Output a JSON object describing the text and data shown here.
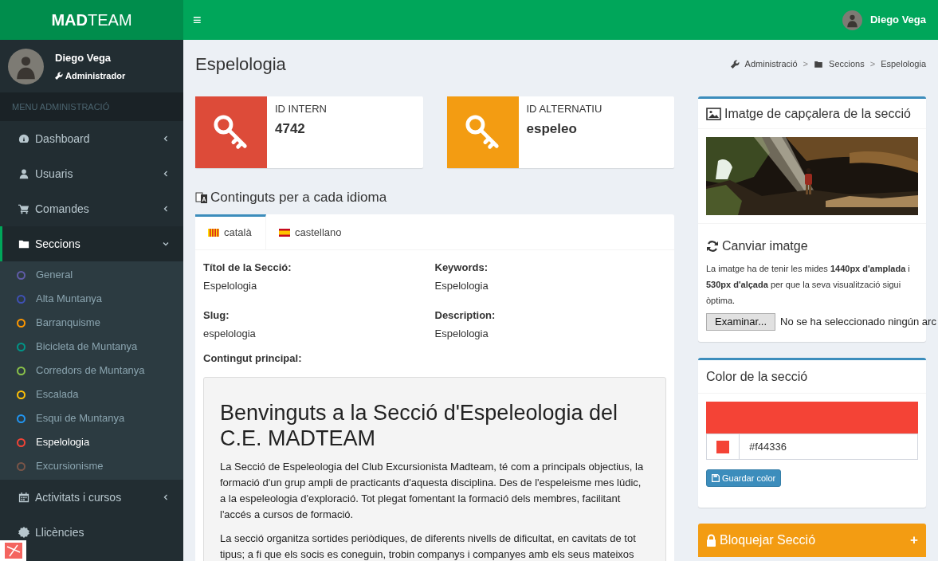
{
  "header": {
    "logo_bold": "MAD",
    "logo_rest": "TEAM",
    "menu_toggle": "≡",
    "user_name": "Diego Vega"
  },
  "sidebar": {
    "user": {
      "name": "Diego Vega",
      "role": "Administrador"
    },
    "menu_title": "MENU ADMINISTRACIÓ",
    "items": [
      {
        "label": "Dashboard",
        "expanded": false,
        "selected": false
      },
      {
        "label": "Usuaris",
        "expanded": false,
        "selected": false
      },
      {
        "label": "Comandes",
        "expanded": false,
        "selected": false
      },
      {
        "label": "Seccions",
        "expanded": true,
        "selected": true,
        "children": [
          {
            "label": "General",
            "color": "#605ca8",
            "selected": false
          },
          {
            "label": "Alta Muntanya",
            "color": "#3f51b5",
            "selected": false
          },
          {
            "label": "Barranquisme",
            "color": "#ff9800",
            "selected": false
          },
          {
            "label": "Bicicleta de Muntanya",
            "color": "#009688",
            "selected": false
          },
          {
            "label": "Corredors de Muntanya",
            "color": "#8bc34a",
            "selected": false
          },
          {
            "label": "Escalada",
            "color": "#ffc107",
            "selected": false
          },
          {
            "label": "Esqui de Muntanya",
            "color": "#2196f3",
            "selected": false
          },
          {
            "label": "Espelologia",
            "color": "#f44336",
            "selected": true
          },
          {
            "label": "Excursionisme",
            "color": "#795548",
            "selected": false
          }
        ]
      },
      {
        "label": "Activitats i cursos",
        "expanded": false,
        "selected": false
      },
      {
        "label": "Llicències",
        "selected": false
      }
    ]
  },
  "page": {
    "title": "Espelologia",
    "breadcrumb": [
      {
        "kind": "link",
        "text": "Administració"
      },
      {
        "kind": "sep",
        "text": ">"
      },
      {
        "kind": "link",
        "text": "Seccions"
      },
      {
        "kind": "sep",
        "text": ">"
      },
      {
        "kind": "current",
        "text": "Espelologia"
      }
    ],
    "info_boxes": [
      {
        "label": "ID INTERN",
        "value": "4742",
        "color": "#dd4b39"
      },
      {
        "label": "ID ALTERNATIU",
        "value": "espeleo",
        "color": "#f39c12"
      }
    ],
    "contents_title": "Continguts per a cada idioma",
    "tabs": [
      {
        "label": "català",
        "selected": true
      },
      {
        "label": "castellano",
        "selected": false
      }
    ],
    "fields": [
      {
        "label": "Títol de la Secció:",
        "value": "Espelologia"
      },
      {
        "label": "Keywords:",
        "value": "Espelologia"
      },
      {
        "label": "Slug:",
        "value": "espelologia"
      },
      {
        "label": "Description:",
        "value": "Espelologia"
      }
    ],
    "main_label": "Contingut principal:",
    "main_heading": "Benvinguts a la Secció d'Espeleologia del C.E. MADTEAM",
    "main_paragraphs": [
      "La Secció de Espeleologia del Club Excursionista Madteam, té com a principals objectius, la formació d'un grup ampli de practicants d'aquesta disciplina. Des de l'espeleisme mes lúdic, a la espeleologia d'exploració. Tot plegat fomentant la formació dels membres, facilitant l'accés a cursos de formació.",
      "La secció organitza sortides periòdiques, de diferents nivells de dificultat, en cavitats de tot tipus; a fi que els socis es coneguin, trobin companys i companyes amb els seus mateixos"
    ]
  },
  "image_panel": {
    "title": "Imatge de capçalera de la secció",
    "change_title": "Canviar imatge",
    "help": "La imatge ha de tenir les mides **1440px d'amplada** i **530px d'alçada** per que la seva visualització sigui òptima.",
    "browse_button": "Examinar...",
    "file_status": "No se ha seleccionado ningún arc"
  },
  "color_panel": {
    "title": "Color de la secció",
    "color": "#f44336",
    "value": "#f44336",
    "save_button": "Guardar color"
  },
  "lock_panel": {
    "title": "Bloquejar Secció",
    "toggle": "+"
  }
}
